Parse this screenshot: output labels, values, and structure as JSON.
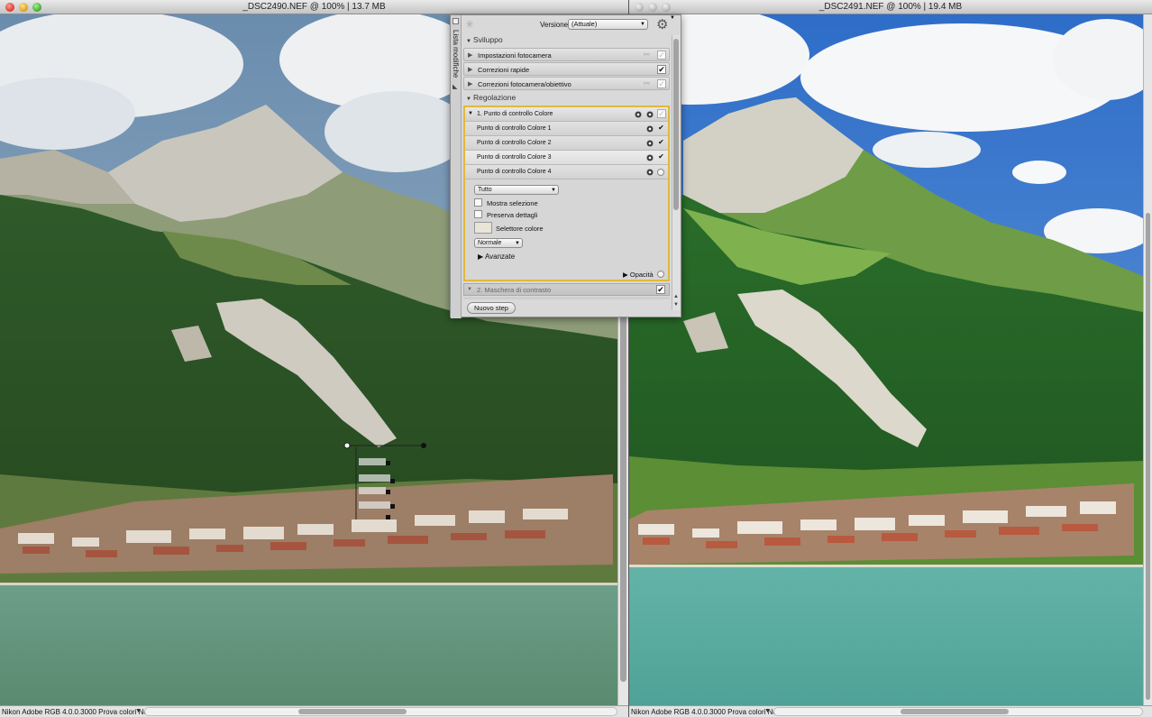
{
  "left_window": {
    "title": "_DSC2490.NEF @ 100% | 13.7 MB",
    "status_text": "Nikon Adobe RGB 4.0.0.3000  Prova colori No"
  },
  "right_window": {
    "title": "_DSC2491.NEF @ 100% | 19.4 MB",
    "status_text": "Nikon Adobe RGB 4.0.0.3000  Prova colori No"
  },
  "panel": {
    "side_tab_label": "Lista modifiche",
    "version_label": "Versione",
    "version_value": "(Attuale)",
    "sviluppo": {
      "header": "Sviluppo",
      "items": [
        {
          "label": "Impostazioni fotocamera",
          "checked": "✓"
        },
        {
          "label": "Correzioni rapide",
          "checked": "✔"
        },
        {
          "label": "Correzioni fotocamera/obiettivo",
          "checked": "✓"
        }
      ]
    },
    "regolazione": {
      "header": "Regolazione",
      "step1_label": "1. Punto di controllo Colore",
      "points": [
        {
          "label": "Punto di controllo Colore 1",
          "check": "✔"
        },
        {
          "label": "Punto di controllo Colore 2",
          "check": "✔"
        },
        {
          "label": "Punto di controllo Colore 3",
          "check": "✔"
        },
        {
          "label": "Punto di controllo Colore 4",
          "check": ""
        }
      ],
      "channel_select": "Tutto",
      "show_selection_label": "Mostra selezione",
      "preserve_details_label": "Preserva dettagli",
      "color_picker_label": "Selettore colore",
      "blend_select": "Normale",
      "advanced_label": "Avanzate",
      "opacity_label": "Opacità",
      "step2_label": "2. Maschera di contrasto",
      "step2_check": "✔"
    },
    "new_step_button": "Nuovo step"
  },
  "colors": {
    "highlight_border": "#e1b93a",
    "panel_bg": "#d9d9d9"
  },
  "icons": [
    "close-icon",
    "minimize-icon",
    "zoom-icon",
    "gear-icon",
    "eye-icon",
    "check-icon",
    "link-icon",
    "disclosure-triangle-icon",
    "spark-icon"
  ]
}
